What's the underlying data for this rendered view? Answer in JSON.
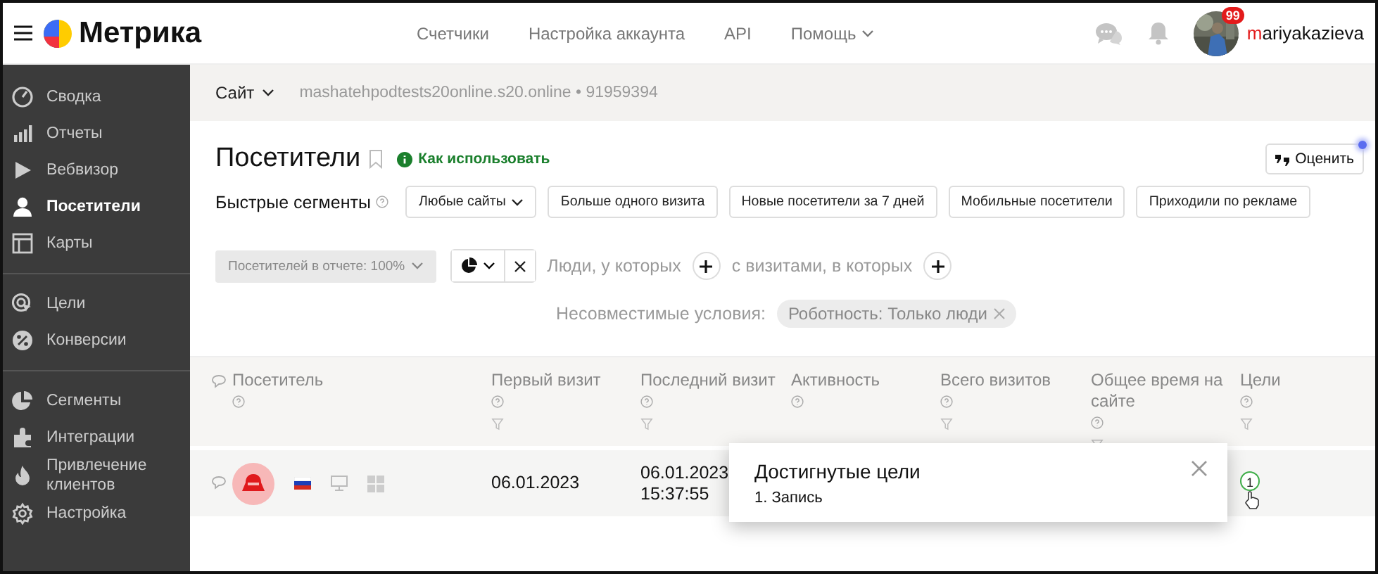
{
  "header": {
    "logo_text": "Метрика",
    "nav": [
      {
        "label": "Счетчики",
        "kind": "link"
      },
      {
        "label": "Настройка аккаунта",
        "kind": "link"
      },
      {
        "label": "API",
        "kind": "link"
      },
      {
        "label": "Помощь",
        "kind": "dropdown"
      }
    ],
    "notifications_badge": "99",
    "login_first": "m",
    "login_rest": "ariyakazieva"
  },
  "sidebar": {
    "groups": [
      [
        {
          "label": "Сводка",
          "selected": false
        },
        {
          "label": "Отчеты",
          "selected": false
        },
        {
          "label": "Вебвизор",
          "selected": false
        },
        {
          "label": "Посетители",
          "selected": true
        },
        {
          "label": "Карты",
          "selected": false
        }
      ],
      [
        {
          "label": "Цели",
          "selected": false
        },
        {
          "label": "Конверсии",
          "selected": false
        }
      ],
      [
        {
          "label": "Сегменты",
          "selected": false
        },
        {
          "label": "Интеграции",
          "selected": false
        },
        {
          "label": "Привлечение клиентов",
          "selected": false
        },
        {
          "label": "Настройка",
          "selected": false
        }
      ]
    ]
  },
  "site_bar": {
    "selector": "Сайт",
    "site": "mashatehpodtests20online.s20.online • 91959394"
  },
  "page": {
    "title": "Посетители",
    "help_link": "Как использовать",
    "rate_button": "Оценить"
  },
  "quick_segments": {
    "label": "Быстрые сегменты",
    "items": [
      {
        "label": "Любые сайты",
        "kind": "dropdown"
      },
      {
        "label": "Больше одного визита",
        "kind": "button"
      },
      {
        "label": "Новые посетители за 7 дней",
        "kind": "button"
      },
      {
        "label": "Мобильные посетители",
        "kind": "button"
      },
      {
        "label": "Приходили по рекламе",
        "kind": "button"
      }
    ]
  },
  "filters": {
    "sample": "Посетителей в отчете: 100%",
    "people_label": "Люди, у которых",
    "visits_label": "с визитами, в которых",
    "incompatible_label": "Несовместимые условия:",
    "chips": [
      {
        "label": "Роботность: Только люди"
      }
    ]
  },
  "table": {
    "columns": [
      {
        "label": "Посетитель",
        "help": true,
        "filter": false
      },
      {
        "label": "Первый визит",
        "help": true,
        "filter": true
      },
      {
        "label": "Последний визит",
        "help": true,
        "filter": true
      },
      {
        "label": "Активность",
        "help": true,
        "filter": false
      },
      {
        "label": "Всего визитов",
        "help": true,
        "filter": true
      },
      {
        "label": "Общее время на сайте",
        "help": true,
        "filter": true
      },
      {
        "label": "Цели",
        "help": true,
        "filter": true
      }
    ],
    "rows": [
      {
        "first_visit": "06.01.2023",
        "last_visit_date": "06.01.2023",
        "last_visit_time": "15:37:55",
        "goals": "1"
      }
    ]
  },
  "popup": {
    "title": "Достигнутые цели",
    "items": [
      "1. Запись"
    ]
  }
}
